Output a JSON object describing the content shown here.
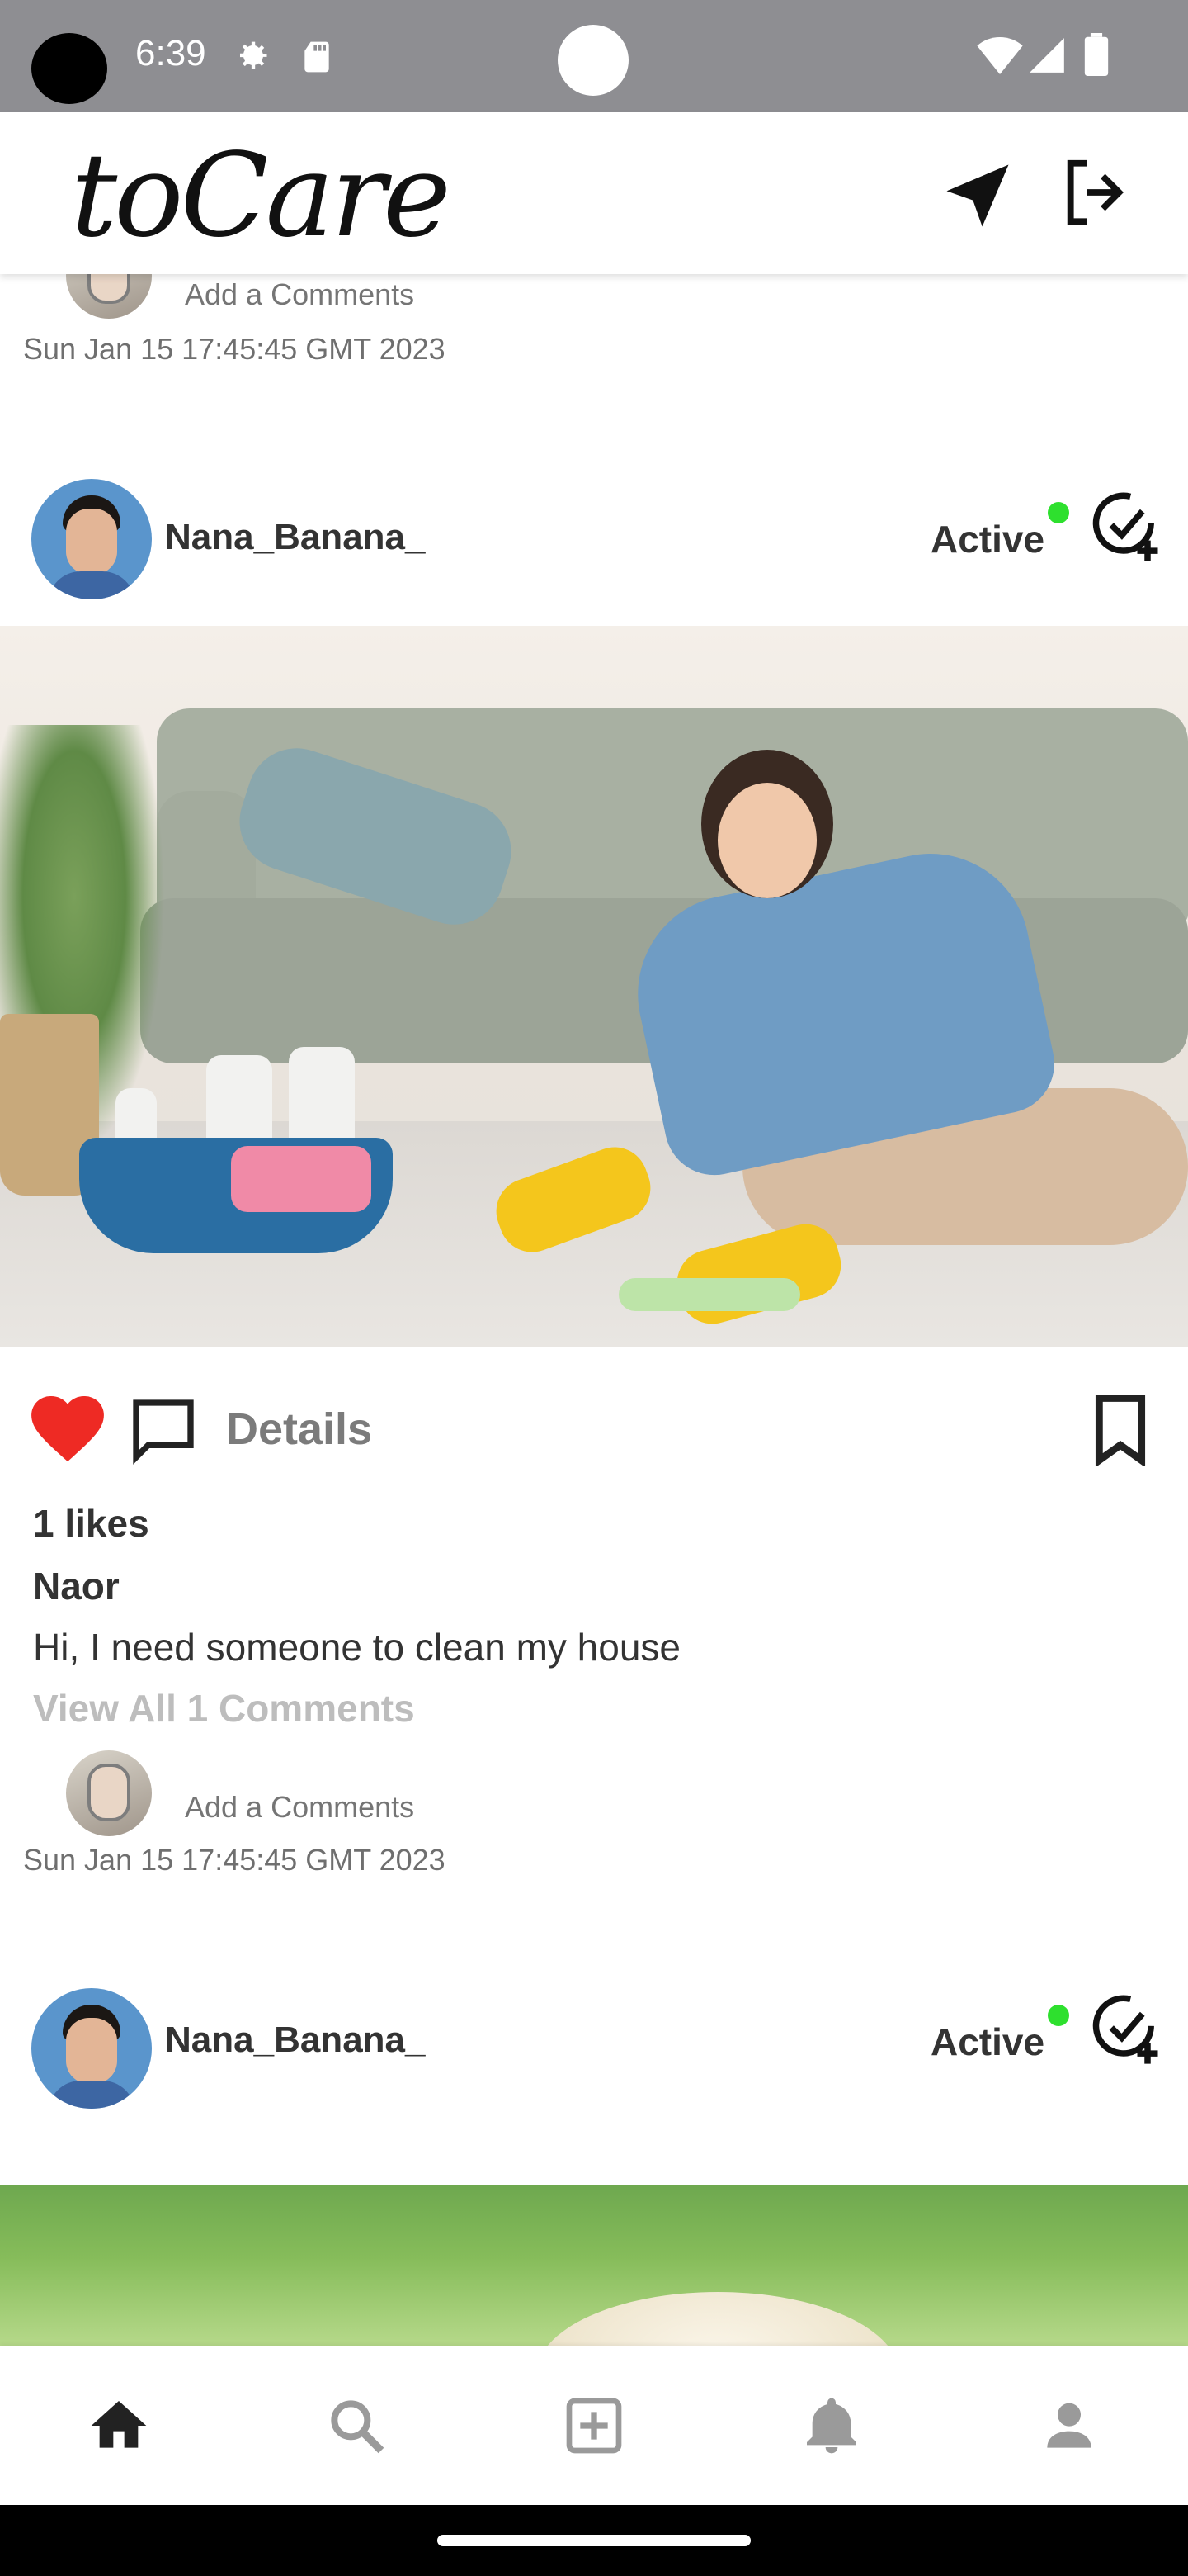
{
  "status_bar": {
    "time": "6:39",
    "icons": [
      "gear-icon",
      "sd-card-icon",
      "wifi-icon",
      "signal-icon",
      "battery-icon"
    ]
  },
  "header": {
    "logo_text": "toCare",
    "icons": [
      "navigation-arrow-icon",
      "logout-icon"
    ]
  },
  "previous_post": {
    "add_comment": "Add a Comments",
    "date": "Sun Jan 15 17:45:45 GMT 2023"
  },
  "post": {
    "username": "Nana_Banana_",
    "status": "Active",
    "status_color": "#2ee02e",
    "details_label": "Details",
    "likes": "1 likes",
    "author": "Naor",
    "caption": "Hi, I need someone to clean my house",
    "view_all": "View All 1 Comments",
    "add_comment": "Add a Comments",
    "date": "Sun Jan 15 17:45:45 GMT 2023",
    "heart_color": "#ee2a24"
  },
  "next_post": {
    "username": "Nana_Banana_",
    "status": "Active"
  },
  "bottom_nav": {
    "items": [
      "home-icon",
      "search-icon",
      "add-post-icon",
      "notifications-icon",
      "profile-icon"
    ]
  }
}
